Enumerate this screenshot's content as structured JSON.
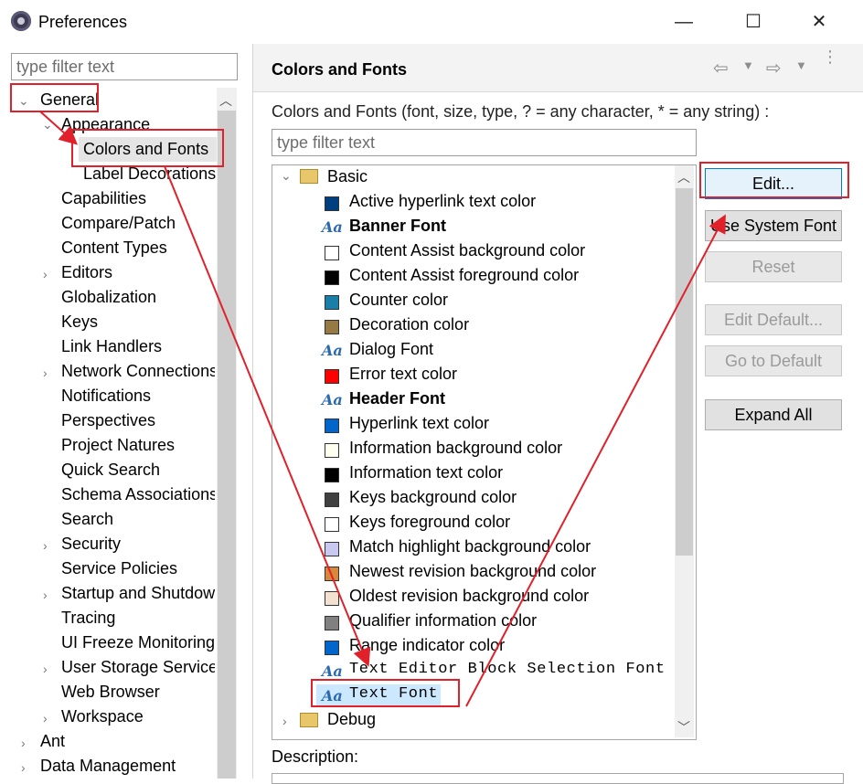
{
  "window": {
    "title": "Preferences",
    "minimize": "—",
    "maximize": "☐",
    "close": "✕"
  },
  "left": {
    "filter_placeholder": "type filter text",
    "items": [
      {
        "label": "General"
      },
      {
        "label": "Appearance"
      },
      {
        "label": "Colors and Fonts"
      },
      {
        "label": "Label Decorations"
      },
      {
        "label": "Capabilities"
      },
      {
        "label": "Compare/Patch"
      },
      {
        "label": "Content Types"
      },
      {
        "label": "Editors"
      },
      {
        "label": "Globalization"
      },
      {
        "label": "Keys"
      },
      {
        "label": "Link Handlers"
      },
      {
        "label": "Network Connections"
      },
      {
        "label": "Notifications"
      },
      {
        "label": "Perspectives"
      },
      {
        "label": "Project Natures"
      },
      {
        "label": "Quick Search"
      },
      {
        "label": "Schema Associations"
      },
      {
        "label": "Search"
      },
      {
        "label": "Security"
      },
      {
        "label": "Service Policies"
      },
      {
        "label": "Startup and Shutdown"
      },
      {
        "label": "Tracing"
      },
      {
        "label": "UI Freeze Monitoring"
      },
      {
        "label": "User Storage Service"
      },
      {
        "label": "Web Browser"
      },
      {
        "label": "Workspace"
      },
      {
        "label": "Ant"
      },
      {
        "label": "Data Management"
      }
    ]
  },
  "right": {
    "title": "Colors and Fonts",
    "description": "Colors and Fonts (font, size, type, ? = any character, * = any string) :",
    "filter_placeholder": "type filter text",
    "groups": [
      {
        "label": "Basic"
      },
      {
        "label": "Debug"
      }
    ],
    "entries": [
      {
        "label": "Active hyperlink text color",
        "kind": "color",
        "color": "#003f7f"
      },
      {
        "label": "Banner Font",
        "kind": "font",
        "bold": true
      },
      {
        "label": "Content Assist background color",
        "kind": "color",
        "color": "#ffffff"
      },
      {
        "label": "Content Assist foreground color",
        "kind": "color",
        "color": "#000000"
      },
      {
        "label": "Counter color",
        "kind": "color",
        "color": "#1a7fa8"
      },
      {
        "label": "Decoration color",
        "kind": "color",
        "color": "#957a44"
      },
      {
        "label": "Dialog Font",
        "kind": "font"
      },
      {
        "label": "Error text color",
        "kind": "color",
        "color": "#ff0000"
      },
      {
        "label": "Header Font",
        "kind": "font",
        "bold": true
      },
      {
        "label": "Hyperlink text color",
        "kind": "color",
        "color": "#0066cc"
      },
      {
        "label": "Information background color",
        "kind": "color",
        "color": "#fffff0"
      },
      {
        "label": "Information text color",
        "kind": "color",
        "color": "#000000"
      },
      {
        "label": "Keys background color",
        "kind": "color",
        "color": "#404040"
      },
      {
        "label": "Keys foreground color",
        "kind": "color",
        "color": "#ffffff"
      },
      {
        "label": "Match highlight background color",
        "kind": "color",
        "color": "#c8c8f0"
      },
      {
        "label": "Newest revision background color",
        "kind": "color",
        "color": "#d8883a"
      },
      {
        "label": "Oldest revision background color",
        "kind": "color",
        "color": "#f2e0d0"
      },
      {
        "label": "Qualifier information color",
        "kind": "color",
        "color": "#808080"
      },
      {
        "label": "Range indicator color",
        "kind": "color",
        "color": "#0066cc"
      },
      {
        "label": "Text Editor Block Selection Font",
        "kind": "font",
        "mono": true
      },
      {
        "label": "Text Font",
        "kind": "font",
        "mono": true,
        "selected": true
      }
    ],
    "buttons": {
      "edit": "Edit...",
      "use_system_font": "Use System Font",
      "reset": "Reset",
      "edit_default": "Edit Default...",
      "go_to_default": "Go to Default",
      "expand_all": "Expand All"
    },
    "description_label": "Description:"
  },
  "annotation_color": "#e0202a"
}
